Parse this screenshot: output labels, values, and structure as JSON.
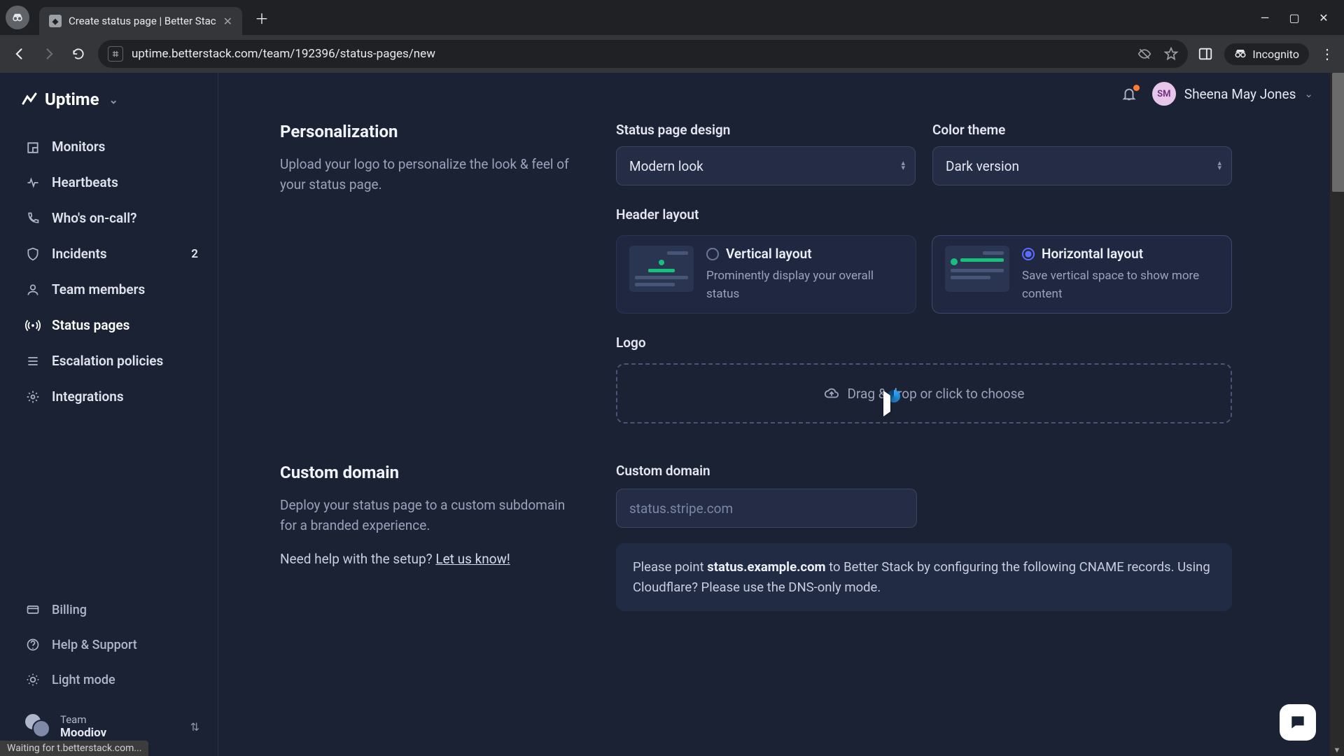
{
  "browser": {
    "tab_title": "Create status page | Better Stac",
    "url": "uptime.betterstack.com/team/192396/status-pages/new",
    "incognito_label": "Incognito",
    "status_text": "Waiting for t.betterstack.com..."
  },
  "header": {
    "brand": "Uptime",
    "user_name": "Sheena May Jones",
    "user_initials": "SM"
  },
  "sidebar": {
    "items": [
      {
        "label": "Monitors"
      },
      {
        "label": "Heartbeats"
      },
      {
        "label": "Who's on-call?"
      },
      {
        "label": "Incidents",
        "badge": "2"
      },
      {
        "label": "Team members"
      },
      {
        "label": "Status pages"
      },
      {
        "label": "Escalation policies"
      },
      {
        "label": "Integrations"
      }
    ],
    "bottom": [
      {
        "label": "Billing"
      },
      {
        "label": "Help & Support"
      },
      {
        "label": "Light mode"
      }
    ],
    "team": {
      "label": "Team",
      "name": "Moodiov"
    }
  },
  "sections": {
    "personalization": {
      "title": "Personalization",
      "desc": "Upload your logo to personalize the look & feel of your status page.",
      "design_label": "Status page design",
      "design_value": "Modern look",
      "theme_label": "Color theme",
      "theme_value": "Dark version",
      "header_layout_label": "Header layout",
      "vertical": {
        "title": "Vertical layout",
        "desc": "Prominently display your overall status"
      },
      "horizontal": {
        "title": "Horizontal layout",
        "desc": "Save vertical space to show more content"
      },
      "logo_label": "Logo",
      "drop_text": "Drag & drop or click to choose"
    },
    "custom_domain": {
      "title": "Custom domain",
      "desc": "Deploy your status page to a custom subdomain for a branded experience.",
      "help_prefix": "Need help with the setup? ",
      "help_link": "Let us know!",
      "field_label": "Custom domain",
      "placeholder": "status.stripe.com",
      "info_pre": "Please point ",
      "info_host": "status.example.com",
      "info_post": " to Better Stack by configuring the following CNAME records. Using Cloudflare? Please use the DNS-only mode."
    }
  }
}
